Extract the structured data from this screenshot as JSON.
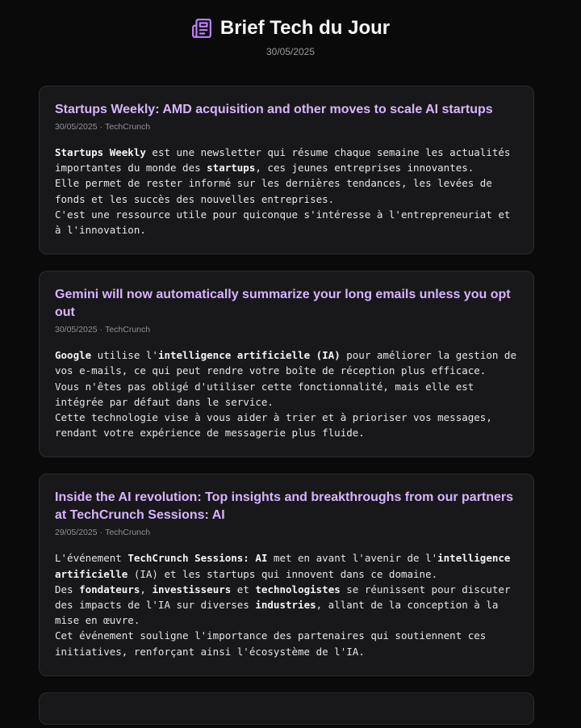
{
  "header": {
    "icon": "newspaper-icon",
    "title": "Brief Tech du Jour",
    "date": "30/05/2025"
  },
  "colors": {
    "background": "#0a0a0b",
    "card": "#18181b",
    "accent": "#d8b4fe",
    "icon": "#c084fc"
  },
  "articles": [
    {
      "title": "Startups Weekly: AMD acquisition and other moves to scale AI startups",
      "date": "30/05/2025",
      "separator": "·",
      "source": "TechCrunch",
      "lines": [
        [
          {
            "b": true,
            "t": "Startups Weekly"
          },
          {
            "b": false,
            "t": " est une newsletter qui résume chaque semaine les actualités importantes du monde des "
          },
          {
            "b": true,
            "t": "startups"
          },
          {
            "b": false,
            "t": ", ces jeunes entreprises innovantes."
          }
        ],
        [
          {
            "b": false,
            "t": "Elle permet de rester informé sur les dernières tendances, les levées de fonds et les succès des nouvelles entreprises."
          }
        ],
        [
          {
            "b": false,
            "t": "C'est une ressource utile pour quiconque s'intéresse à l'entrepreneuriat et à l'innovation."
          }
        ]
      ]
    },
    {
      "title": "Gemini will now automatically summarize your long emails unless you opt out",
      "date": "30/05/2025",
      "separator": "·",
      "source": "TechCrunch",
      "lines": [
        [
          {
            "b": true,
            "t": "Google"
          },
          {
            "b": false,
            "t": " utilise l'"
          },
          {
            "b": true,
            "t": "intelligence artificielle (IA)"
          },
          {
            "b": false,
            "t": " pour améliorer la gestion de vos e-mails, ce qui peut rendre votre boîte de réception plus efficace."
          }
        ],
        [
          {
            "b": false,
            "t": "Vous n'êtes pas obligé d'utiliser cette fonctionnalité, mais elle est intégrée par défaut dans le service."
          }
        ],
        [
          {
            "b": false,
            "t": "Cette technologie vise à vous aider à trier et à prioriser vos messages, rendant votre expérience de messagerie plus fluide."
          }
        ]
      ]
    },
    {
      "title": "Inside the AI revolution: Top insights and breakthroughs from our partners at TechCrunch Sessions: AI",
      "date": "29/05/2025",
      "separator": "·",
      "source": "TechCrunch",
      "lines": [
        [
          {
            "b": false,
            "t": "L'événement "
          },
          {
            "b": true,
            "t": "TechCrunch Sessions: AI"
          },
          {
            "b": false,
            "t": " met en avant l'avenir de l'"
          },
          {
            "b": true,
            "t": "intelligence artificielle"
          },
          {
            "b": false,
            "t": " (IA) et les startups qui innovent dans ce domaine."
          }
        ],
        [
          {
            "b": false,
            "t": "Des "
          },
          {
            "b": true,
            "t": "fondateurs"
          },
          {
            "b": false,
            "t": ", "
          },
          {
            "b": true,
            "t": "investisseurs"
          },
          {
            "b": false,
            "t": " et "
          },
          {
            "b": true,
            "t": "technologistes"
          },
          {
            "b": false,
            "t": " se réunissent pour discuter des impacts de l'IA sur diverses "
          },
          {
            "b": true,
            "t": "industries"
          },
          {
            "b": false,
            "t": ", allant de la conception à la mise en œuvre."
          }
        ],
        [
          {
            "b": false,
            "t": "Cet événement souligne l'importance des partenaires qui soutiennent ces initiatives, renforçant ainsi l'écosystème de l'IA."
          }
        ]
      ]
    }
  ]
}
